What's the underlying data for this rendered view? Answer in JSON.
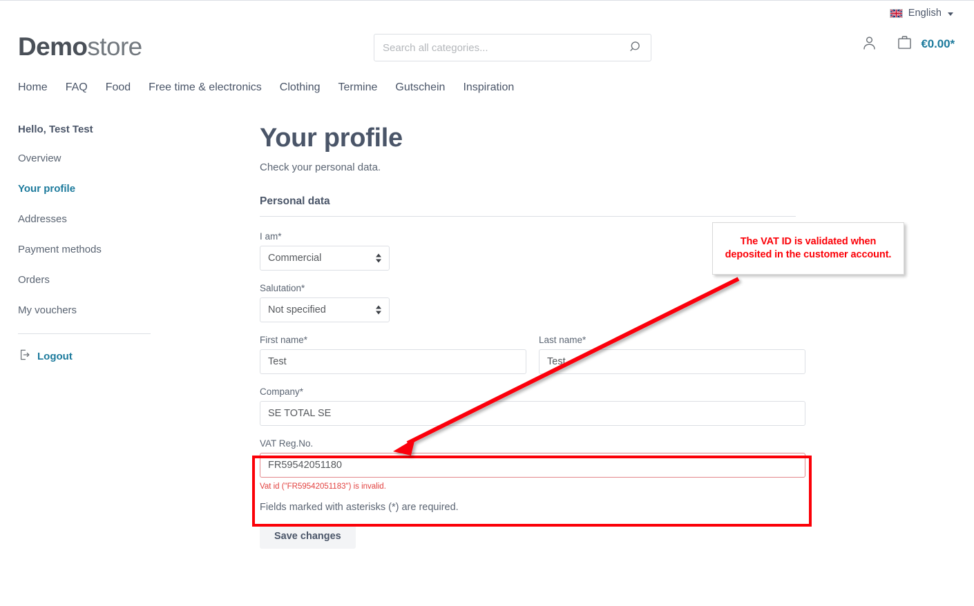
{
  "utility": {
    "flag_icon": "uk-flag-icon",
    "language": "English",
    "caret_icon": "chevron-down-icon"
  },
  "header": {
    "logo_bold": "Demo",
    "logo_normal": "store",
    "search": {
      "placeholder": "Search all categories...",
      "value": "",
      "icon": "search-icon"
    },
    "account_icon": "user-account-icon",
    "cart_icon": "shopping-bag-icon",
    "cart_total": "€0.00*"
  },
  "nav": {
    "items": [
      {
        "label": "Home"
      },
      {
        "label": "FAQ"
      },
      {
        "label": "Food"
      },
      {
        "label": "Free time & electronics"
      },
      {
        "label": "Clothing"
      },
      {
        "label": "Termine"
      },
      {
        "label": "Gutschein"
      },
      {
        "label": "Inspiration"
      }
    ]
  },
  "sidebar": {
    "greeting": "Hello, Test Test",
    "items": [
      {
        "label": "Overview",
        "active": false
      },
      {
        "label": "Your profile",
        "active": true
      },
      {
        "label": "Addresses",
        "active": false
      },
      {
        "label": "Payment methods",
        "active": false
      },
      {
        "label": "Orders",
        "active": false
      },
      {
        "label": "My vouchers",
        "active": false
      }
    ],
    "logout_label": "Logout",
    "logout_icon": "logout-icon"
  },
  "main": {
    "title": "Your profile",
    "subtitle": "Check your personal data.",
    "section_title": "Personal data",
    "fields": {
      "i_am": {
        "label": "I am*",
        "value": "Commercial"
      },
      "salutation": {
        "label": "Salutation*",
        "value": "Not specified"
      },
      "first_name": {
        "label": "First name*",
        "value": "Test"
      },
      "last_name": {
        "label": "Last name*",
        "value": "Test"
      },
      "company": {
        "label": "Company*",
        "value": "SE TOTAL SE"
      },
      "vat": {
        "label": "VAT Reg.No.",
        "value": "FR59542051180",
        "error": "Vat id (\"FR59542051183\") is invalid."
      }
    },
    "required_hint": "Fields marked with asterisks (*) are required.",
    "save_label": "Save changes"
  },
  "annotation": {
    "callout_text": "The VAT ID is validated when deposited in the customer account.",
    "color": "#fb0007"
  },
  "colors": {
    "accent_teal": "#1c7a9c",
    "text_dark": "#4a5568",
    "text_muted": "#5a6472",
    "border": "#dcdfe4",
    "error_red": "#e2413f",
    "annotation_red": "#fb0007"
  }
}
